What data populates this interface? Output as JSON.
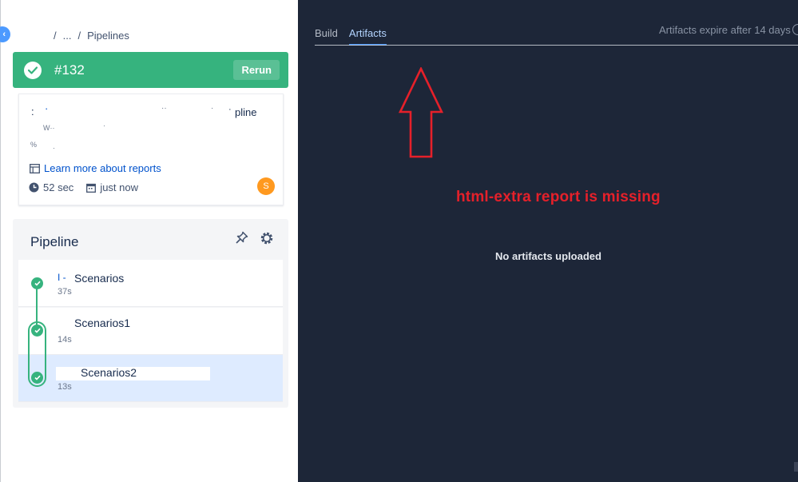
{
  "breadcrumb": {
    "sep1": "/",
    "ellipsis": "...",
    "sep2": "/",
    "current": "Pipelines"
  },
  "build": {
    "number": "#132",
    "rerun_label": "Rerun",
    "status_color": "#36b37e"
  },
  "info": {
    "line1_fragment": "pline",
    "learn_more": "Learn more about reports",
    "duration": "52 sec",
    "started": "just now",
    "avatar_initial": "S"
  },
  "pipeline": {
    "title": "Pipeline",
    "steps": [
      {
        "name": "Scenarios",
        "prefix": "I -",
        "time": "37s"
      },
      {
        "name": "Scenarios1",
        "time": "14s"
      },
      {
        "name": "Scenarios2",
        "time": "13s"
      }
    ]
  },
  "artifacts_panel": {
    "tabs": [
      "Build",
      "Artifacts"
    ],
    "active_tab": "Artifacts",
    "expire_text": "Artifacts expire after 14 days",
    "empty_text": "No artifacts uploaded",
    "annotation": "html-extra report is missing",
    "annotation_color": "#e5202a",
    "background": "#1d2638"
  }
}
